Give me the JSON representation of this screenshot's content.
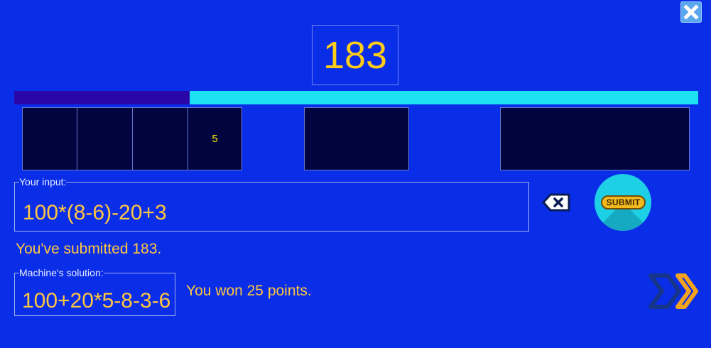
{
  "target": {
    "value": "183"
  },
  "progress": {
    "fraction": 0.257
  },
  "tiles": [
    "",
    "",
    "",
    "5",
    "",
    ""
  ],
  "input_panel": {
    "legend": "Your input:",
    "expression": "100*(8-6)-20+3"
  },
  "buttons": {
    "submit_label": "SUBMIT"
  },
  "messages": {
    "submitted": "You've submitted 183.",
    "result": "You won 25 points."
  },
  "solution_panel": {
    "legend": "Machine's solution:",
    "expression": "100+20*5-8-3-6"
  },
  "icons": {
    "close": "close-icon",
    "backspace": "backspace-icon",
    "next": "next-chevrons-icon"
  },
  "colors": {
    "background": "#0a2ee8",
    "accent_text": "#ffc640",
    "progress_track": "#1ee0f5",
    "progress_fill": "#2a06a8",
    "tile_bg": "#01043f",
    "submit_bg": "#1ed0e6"
  }
}
